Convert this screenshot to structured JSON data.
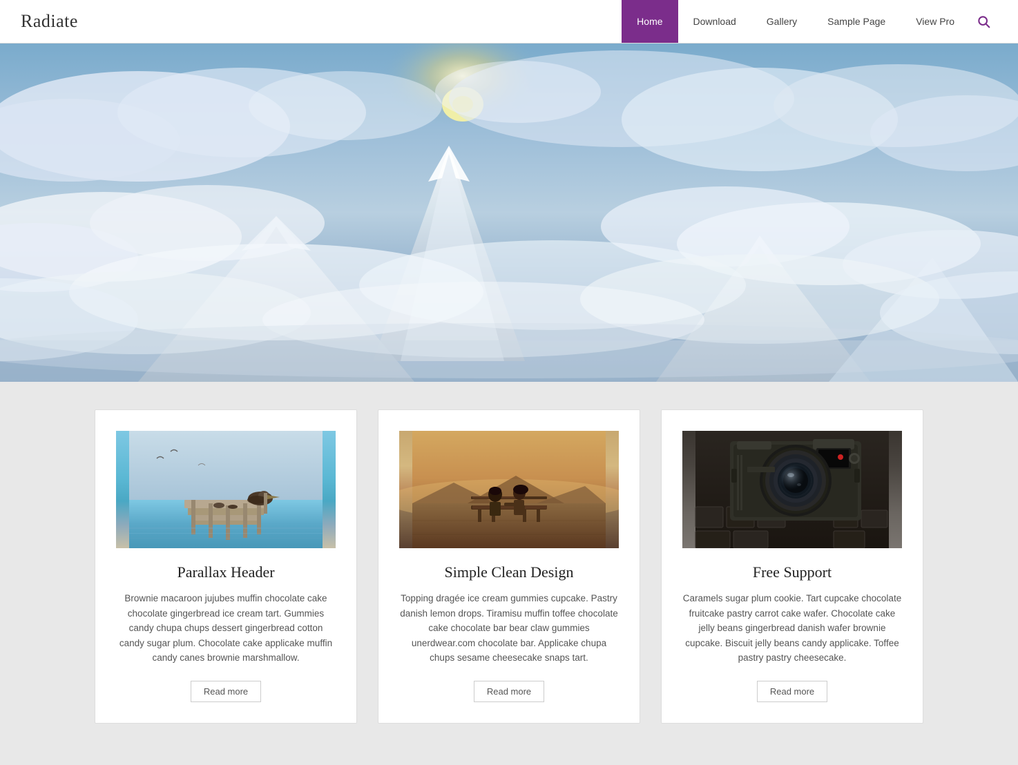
{
  "site": {
    "title": "Radiate"
  },
  "nav": {
    "items": [
      {
        "label": "Home",
        "active": true
      },
      {
        "label": "Download",
        "active": false
      },
      {
        "label": "Gallery",
        "active": false
      },
      {
        "label": "Sample Page",
        "active": false
      },
      {
        "label": "View Pro",
        "active": false
      }
    ],
    "search_icon": "🔍"
  },
  "hero": {
    "alt": "Mountain landscape with clouds"
  },
  "cards": [
    {
      "title": "Parallax Header",
      "body": "Brownie macaroon jujubes muffin chocolate cake chocolate gingerbread ice cream tart. Gummies candy chupa chups dessert gingerbread cotton candy sugar plum. Chocolate cake applicake muffin candy canes brownie marshmallow.",
      "read_more": "Read more",
      "img_type": "pelican"
    },
    {
      "title": "Simple Clean Design",
      "body": "Topping dragée ice cream gummies cupcake. Pastry danish lemon drops. Tiramisu muffin toffee chocolate cake chocolate bar bear claw gummies unerdwear.com chocolate bar. Applicake chupa chups sesame cheesecake snaps tart.",
      "read_more": "Read more",
      "img_type": "couple"
    },
    {
      "title": "Free Support",
      "body": "Caramels sugar plum cookie. Tart cupcake chocolate fruitcake pastry carrot cake wafer. Chocolate cake jelly beans gingerbread danish wafer brownie cupcake. Biscuit jelly beans candy applicake. Toffee pastry pastry cheesecake.",
      "read_more": "Read more",
      "img_type": "camera"
    }
  ],
  "colors": {
    "accent": "#7b2d8b",
    "nav_active_bg": "#7b2d8b",
    "nav_active_text": "#ffffff"
  }
}
